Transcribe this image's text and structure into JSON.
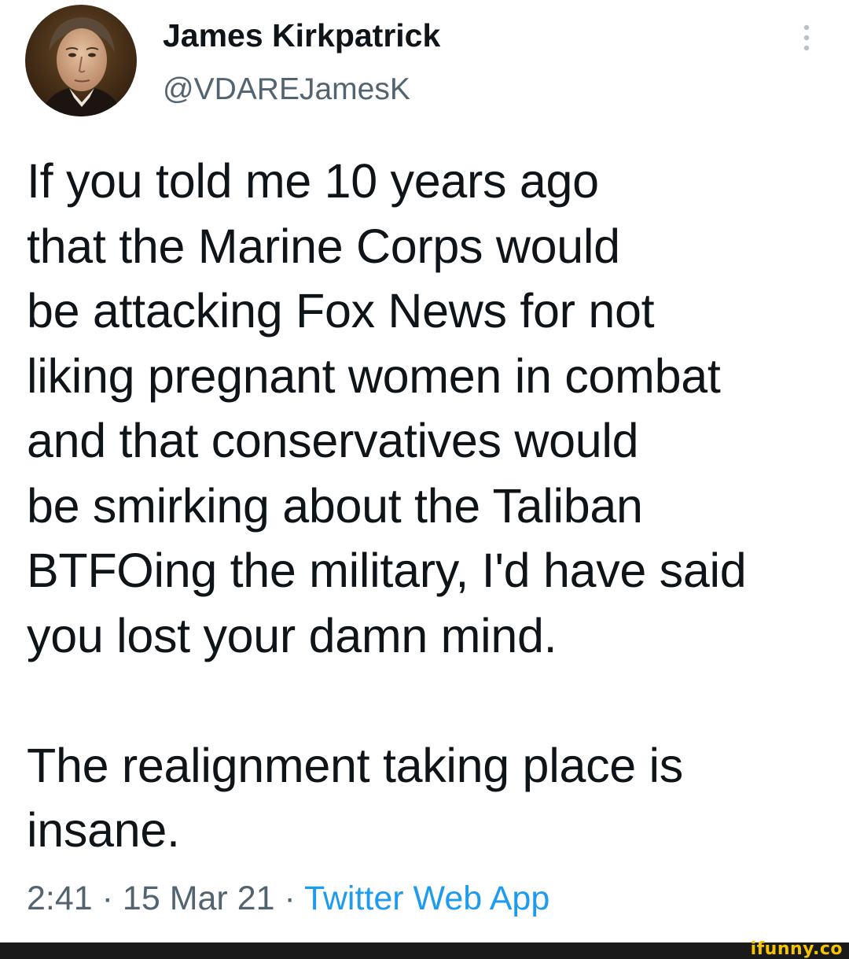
{
  "tweet": {
    "author": {
      "display_name": "James Kirkpatrick",
      "handle": "@VDAREJamesK"
    },
    "more_icon": "more-vertical-icon",
    "text": "If you told me 10 years ago\nthat the Marine Corps would\nbe attacking Fox News for not\nliking pregnant women in combat\nand that conservatives would\nbe smirking about the Taliban\nBTFOing the military, I'd have said\nyou lost your damn mind.\n\nThe realignment taking place is\ninsane.",
    "time": "2:41",
    "separator": " · ",
    "date": "15 Mar 21",
    "source": "Twitter Web App"
  },
  "watermark": {
    "text": "ifunny.co"
  },
  "colors": {
    "text": "#0f1419",
    "secondary": "#536471",
    "link": "#1d9bf0",
    "footer_bar": "#1a1a1a",
    "watermark": "#f5c400"
  }
}
